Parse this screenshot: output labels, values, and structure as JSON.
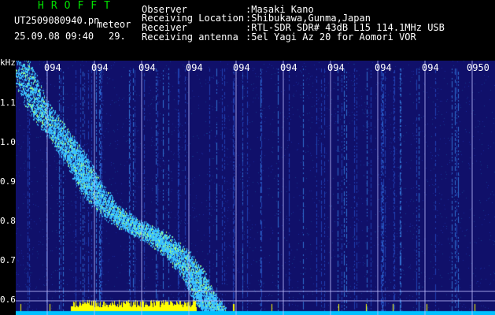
{
  "header": {
    "app_title": "HROFFT",
    "file_name": "UT2509080940.pn",
    "file_tag": "meteor",
    "date_time": "25.09.08 09:40",
    "counter": "29.",
    "info": [
      {
        "label": "Observer",
        "value": ":Masaki Kano"
      },
      {
        "label": "Receiving Location",
        "value": ":Shibukawa,Gunma,Japan"
      },
      {
        "label": "Receiver",
        "value": ":RTL-SDR SDR# 43dB L15 114.1MHz USB"
      },
      {
        "label": "Receiving antenna",
        "value": ":5el Yagi Az 20 for Aomori VOR"
      }
    ]
  },
  "spectrogram": {
    "y_unit": "kHz",
    "y_ticks": [
      "1.1",
      "1.0",
      "0.9",
      "0.8",
      "0.7",
      "0.6"
    ],
    "x_ticks": [
      "094",
      "094",
      "094",
      "094",
      "094",
      "094",
      "094",
      "094",
      "094",
      "0950"
    ],
    "colors": {
      "background": "#10106a",
      "signal": "#39c0ff",
      "signal_strong": "#a0ff80",
      "noise_bar": "#ffff00",
      "baseline": "#00c0ff",
      "grid": "#c0c0ff"
    }
  }
}
